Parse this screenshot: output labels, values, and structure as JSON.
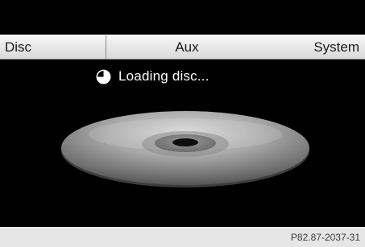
{
  "menu": {
    "tabs": [
      {
        "label": "Disc"
      },
      {
        "label": "Aux"
      },
      {
        "label": "System"
      }
    ]
  },
  "status": {
    "icon": "busy-clock-icon",
    "text": "Loading disc..."
  },
  "media": {
    "icon": "disc-icon"
  },
  "footer": {
    "reference_code": "P82.87-2037-31"
  }
}
